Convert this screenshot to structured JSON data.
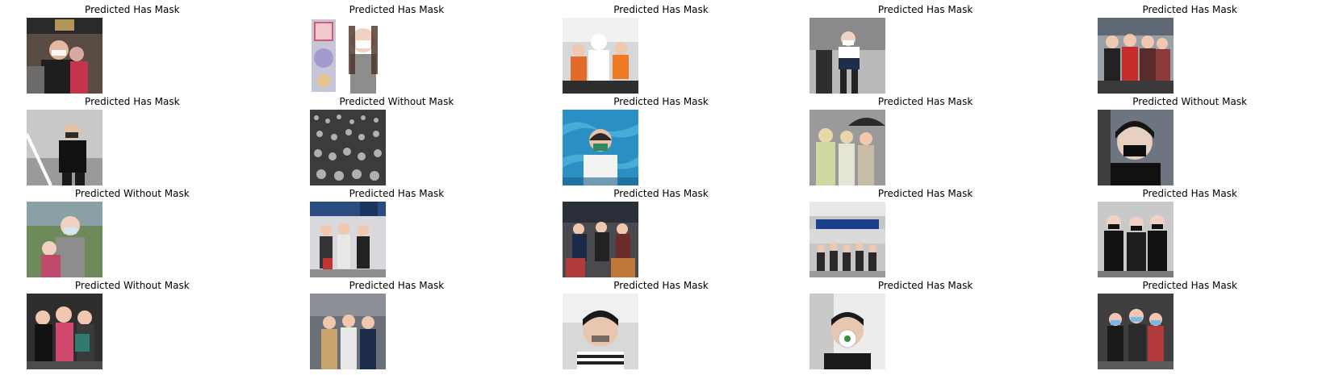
{
  "grid": {
    "rows": 4,
    "cols": 5
  },
  "panels": [
    {
      "title": "Predicted Has Mask",
      "image": "people-in-station-with-masks"
    },
    {
      "title": "Predicted Has Mask",
      "image": "woman-wearing-mask-advert"
    },
    {
      "title": "Predicted Has Mask",
      "image": "workers-in-protective-suits"
    },
    {
      "title": "Predicted Has Mask",
      "image": "person-walking-in-airport"
    },
    {
      "title": "Predicted Has Mask",
      "image": "group-wearing-masks"
    },
    {
      "title": "Predicted Has Mask",
      "image": "man-sitting-on-stairs"
    },
    {
      "title": "Predicted Without Mask",
      "image": "crowd-of-people"
    },
    {
      "title": "Predicted Has Mask",
      "image": "woman-with-mask-blue-background"
    },
    {
      "title": "Predicted Has Mask",
      "image": "people-with-umbrella"
    },
    {
      "title": "Predicted Without Mask",
      "image": "young-man-black-mask"
    },
    {
      "title": "Predicted Without Mask",
      "image": "woman-with-child"
    },
    {
      "title": "Predicted Has Mask",
      "image": "people-in-terminal"
    },
    {
      "title": "Predicted Has Mask",
      "image": "travellers-with-luggage"
    },
    {
      "title": "Predicted Has Mask",
      "image": "airport-hall"
    },
    {
      "title": "Predicted Has Mask",
      "image": "group-of-young-men"
    },
    {
      "title": "Predicted Without Mask",
      "image": "people-in-costumes"
    },
    {
      "title": "Predicted Has Mask",
      "image": "people-at-checkpoint"
    },
    {
      "title": "Predicted Has Mask",
      "image": "man-selfie"
    },
    {
      "title": "Predicted Has Mask",
      "image": "man-with-respirator"
    },
    {
      "title": "Predicted Has Mask",
      "image": "crowd-with-masks"
    }
  ],
  "colors": {
    "background": "#ffffff",
    "text": "#000000"
  }
}
